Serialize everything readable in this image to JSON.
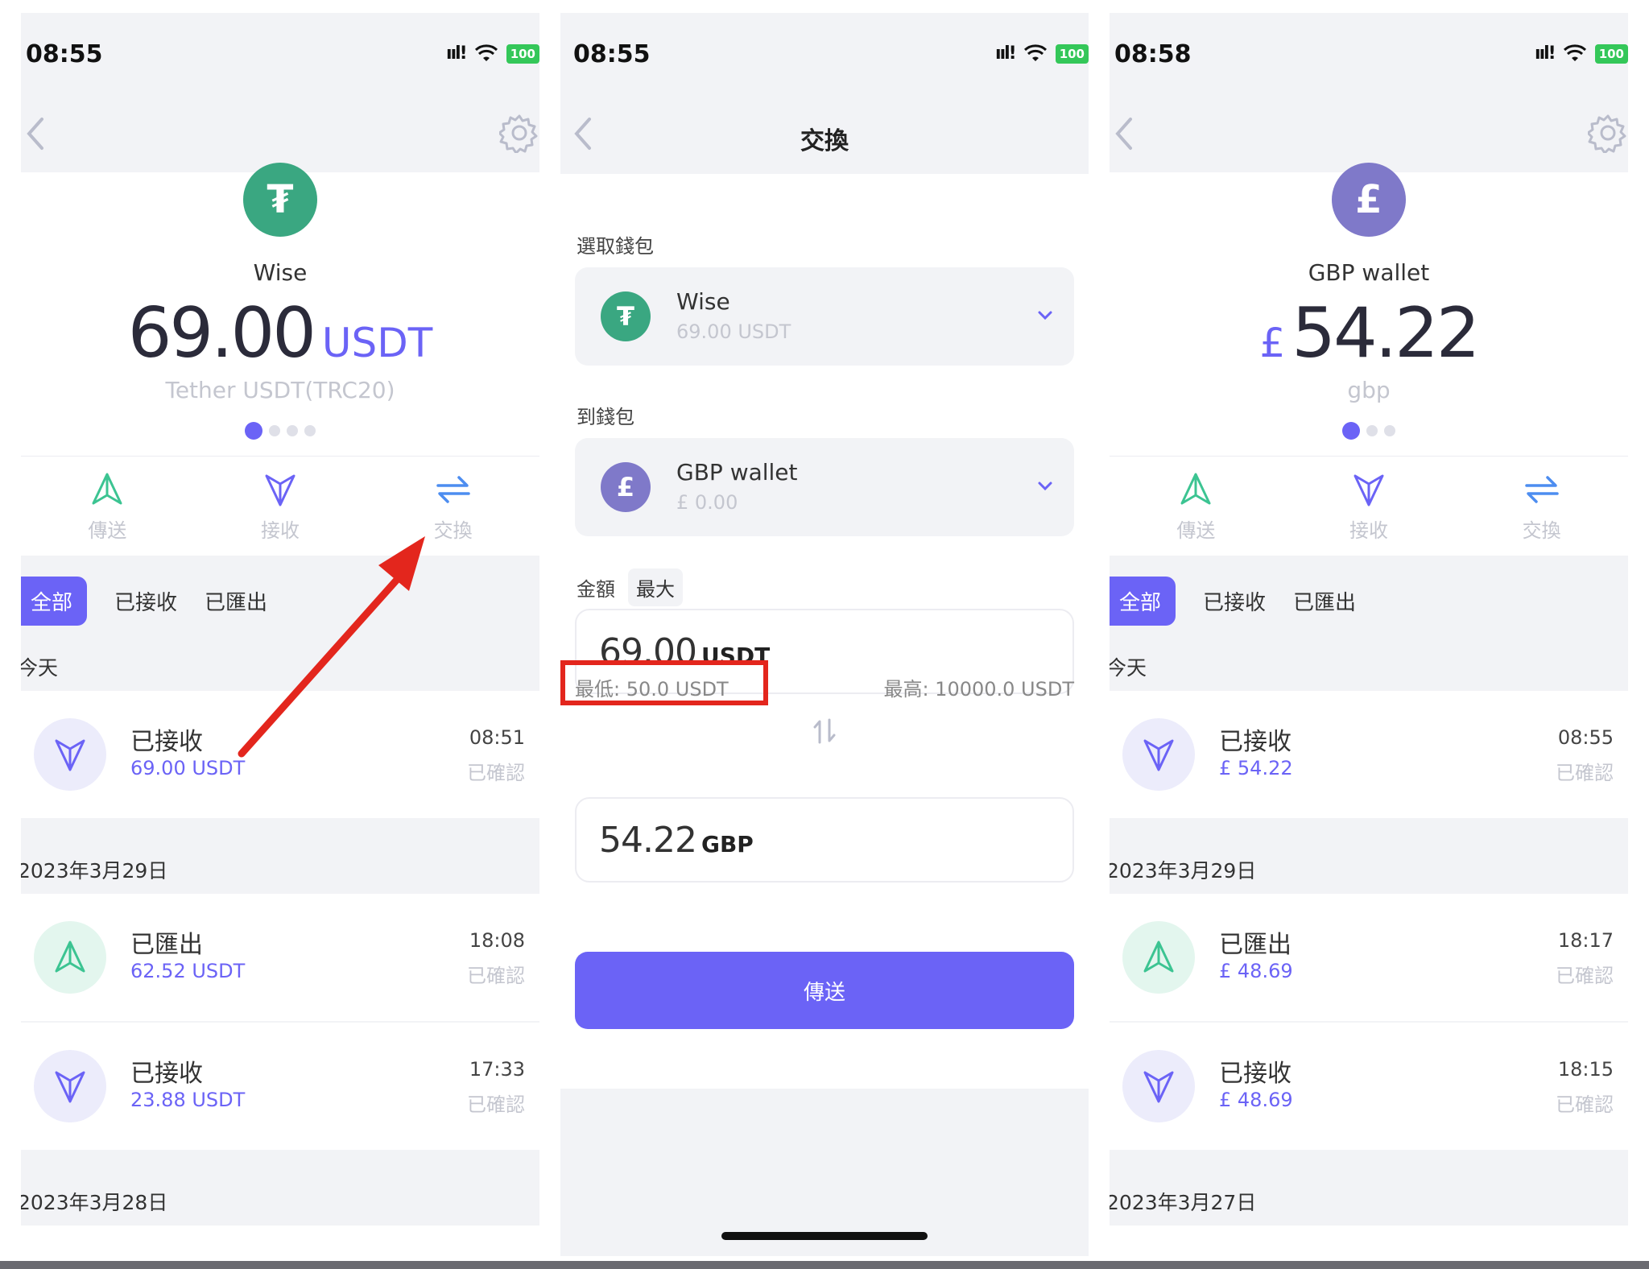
{
  "screen1": {
    "time": "08:55",
    "battery": "100",
    "wallet_name": "Wise",
    "balance": "69.00",
    "unit": "USDT",
    "subtitle": "Tether USDT(TRC20)",
    "actions": [
      "傳送",
      "接收",
      "交換"
    ],
    "tabs": [
      "全部",
      "已接收",
      "已匯出"
    ],
    "groups": [
      "今天",
      "2023年3月29日",
      "2023年3月28日"
    ],
    "transactions": [
      {
        "title": "已接收",
        "amount": "69.00 USDT",
        "time": "08:51",
        "status": "已確認"
      },
      {
        "title": "已匯出",
        "amount": "62.52 USDT",
        "time": "18:08",
        "status": "已確認"
      },
      {
        "title": "已接收",
        "amount": "23.88 USDT",
        "time": "17:33",
        "status": "已確認"
      }
    ]
  },
  "screen2": {
    "time": "08:55",
    "battery": "100",
    "title": "交換",
    "from_label": "選取錢包",
    "from_wallet": {
      "name": "Wise",
      "balance": "69.00 USDT"
    },
    "to_label": "到錢包",
    "to_wallet": {
      "name": "GBP wallet",
      "balance": "£ 0.00"
    },
    "amount_label": "金額",
    "max_label": "最大",
    "amount_value": "69.00",
    "amount_unit": "USDT",
    "min_text": "最低: 50.0 USDT",
    "max_text": "最高: 10000.0 USDT",
    "receive_value": "54.22",
    "receive_unit": "GBP",
    "send_label": "傳送"
  },
  "screen3": {
    "time": "08:58",
    "battery": "100",
    "wallet_name": "GBP wallet",
    "currency_symbol": "£",
    "balance": "54.22",
    "subtitle": "gbp",
    "actions": [
      "傳送",
      "接收",
      "交換"
    ],
    "tabs": [
      "全部",
      "已接收",
      "已匯出"
    ],
    "groups": [
      "今天",
      "2023年3月29日",
      "2023年3月27日"
    ],
    "transactions": [
      {
        "title": "已接收",
        "amount": "£ 54.22",
        "time": "08:55",
        "status": "已確認"
      },
      {
        "title": "已匯出",
        "amount": "£ 48.69",
        "time": "18:17",
        "status": "已確認"
      },
      {
        "title": "已接收",
        "amount": "£ 48.69",
        "time": "18:15",
        "status": "已確認"
      }
    ]
  },
  "colors": {
    "accent": "#6b63f6",
    "tether": "#3aa781",
    "gbp_coin": "#7f79c9",
    "highlight": "#e3261d"
  },
  "icons": {
    "tether": "₮",
    "gbp": "£"
  }
}
